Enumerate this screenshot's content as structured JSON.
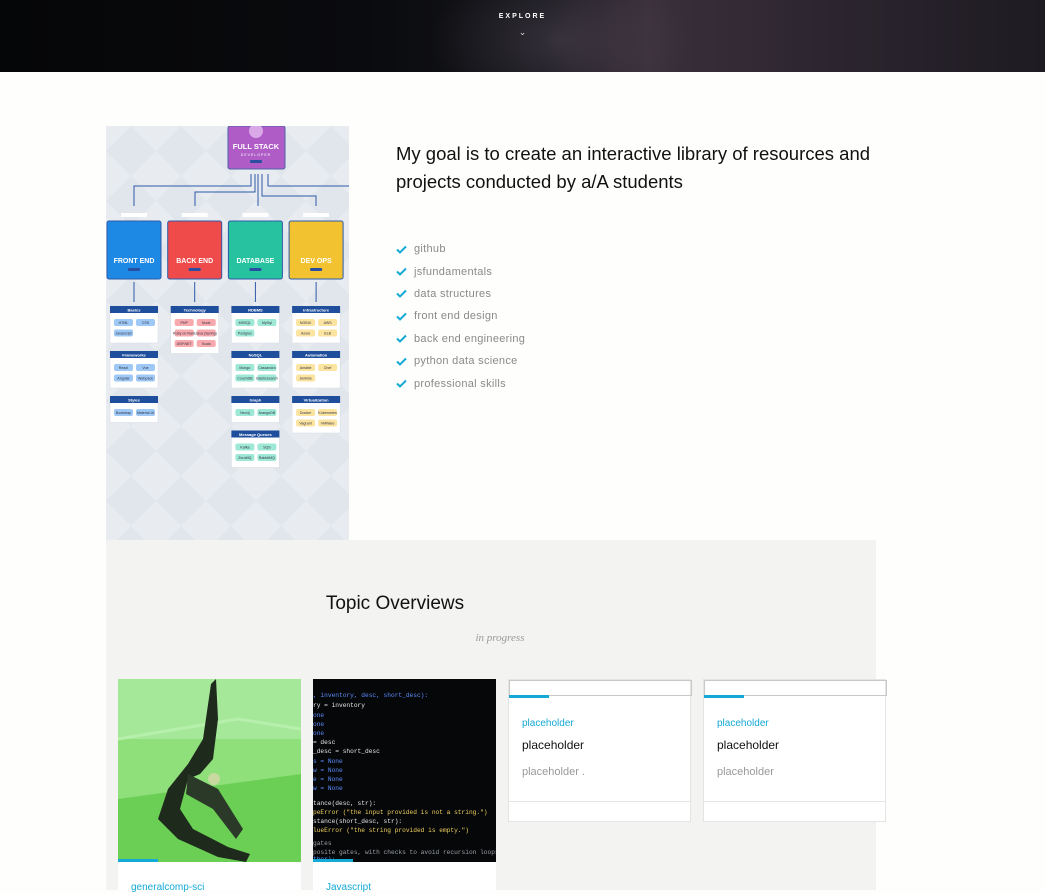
{
  "hero": {
    "explore_label": "EXPLORE",
    "chevron": "⌄"
  },
  "roadmap": {
    "top_box": {
      "title": "FULL STACK",
      "subtitle": "DEVELOPER",
      "color": "#b05cc7"
    },
    "columns": [
      {
        "role": "FRONT END",
        "color": "#1e88e5",
        "groups": [
          {
            "header": "Basics",
            "tags": [
              "HTML",
              "CSS",
              "Javascript"
            ]
          },
          {
            "header": "Frameworks",
            "tags": [
              "React",
              "Vue",
              "Angular",
              "Webpack"
            ]
          },
          {
            "header": "Styles",
            "tags": [
              "Bootstrap",
              "Material UI"
            ]
          }
        ]
      },
      {
        "role": "BACK END",
        "color": "#ef4b4b",
        "groups": [
          {
            "header": "Technology",
            "tags": [
              "PHP",
              "Node",
              "Ruby on Rails",
              "Java (Spring)",
              "ASP.NET",
              "Scala"
            ]
          }
        ]
      },
      {
        "role": "DATABASE",
        "color": "#27c3a0",
        "groups": [
          {
            "header": "RDBMS",
            "tags": [
              "MSSQL",
              "MySql",
              "Postgres"
            ]
          },
          {
            "header": "NoSQL",
            "tags": [
              "Mongo",
              "Cassandra",
              "CouchDB",
              "Elasticsearch"
            ]
          },
          {
            "header": "Graph",
            "tags": [
              "Neo4j",
              "ArangoDB"
            ]
          },
          {
            "header": "Message Queues",
            "tags": [
              "Kafka",
              "SQS",
              "ZeroMQ",
              "RabbitMQ"
            ]
          }
        ]
      },
      {
        "role": "DEV OPS",
        "color": "#f2c230",
        "groups": [
          {
            "header": "Infrastructure",
            "tags": [
              "NGINX",
              "AWS",
              "Azure",
              "ELB"
            ]
          },
          {
            "header": "Automation",
            "tags": [
              "Ansible",
              "Chef",
              "Jenkins"
            ]
          },
          {
            "header": "Virtualization",
            "tags": [
              "Docker",
              "Kubernetes",
              "Vagrant",
              "VMWare"
            ]
          }
        ]
      }
    ]
  },
  "goal": {
    "title": "My goal is to create an interactive library of resources and projects conducted by a/A students",
    "items": [
      "github",
      "jsfundamentals",
      "data structures",
      "front end design",
      "back end engineering",
      "python data science",
      "professional skills"
    ],
    "check_color": "#15a9d6"
  },
  "topics": {
    "title": "Topic Overviews",
    "subtitle": "in progress",
    "cards": [
      {
        "category": "generalcomp-sci",
        "image": "green-photo"
      },
      {
        "category": "Javascript",
        "image": "code-screenshot"
      },
      {
        "category": "placeholder",
        "title": "placeholder",
        "desc": "placeholder ."
      },
      {
        "category": "placeholder",
        "title": "placeholder",
        "desc": "placeholder"
      }
    ],
    "accent_color": "#15a9d6"
  }
}
